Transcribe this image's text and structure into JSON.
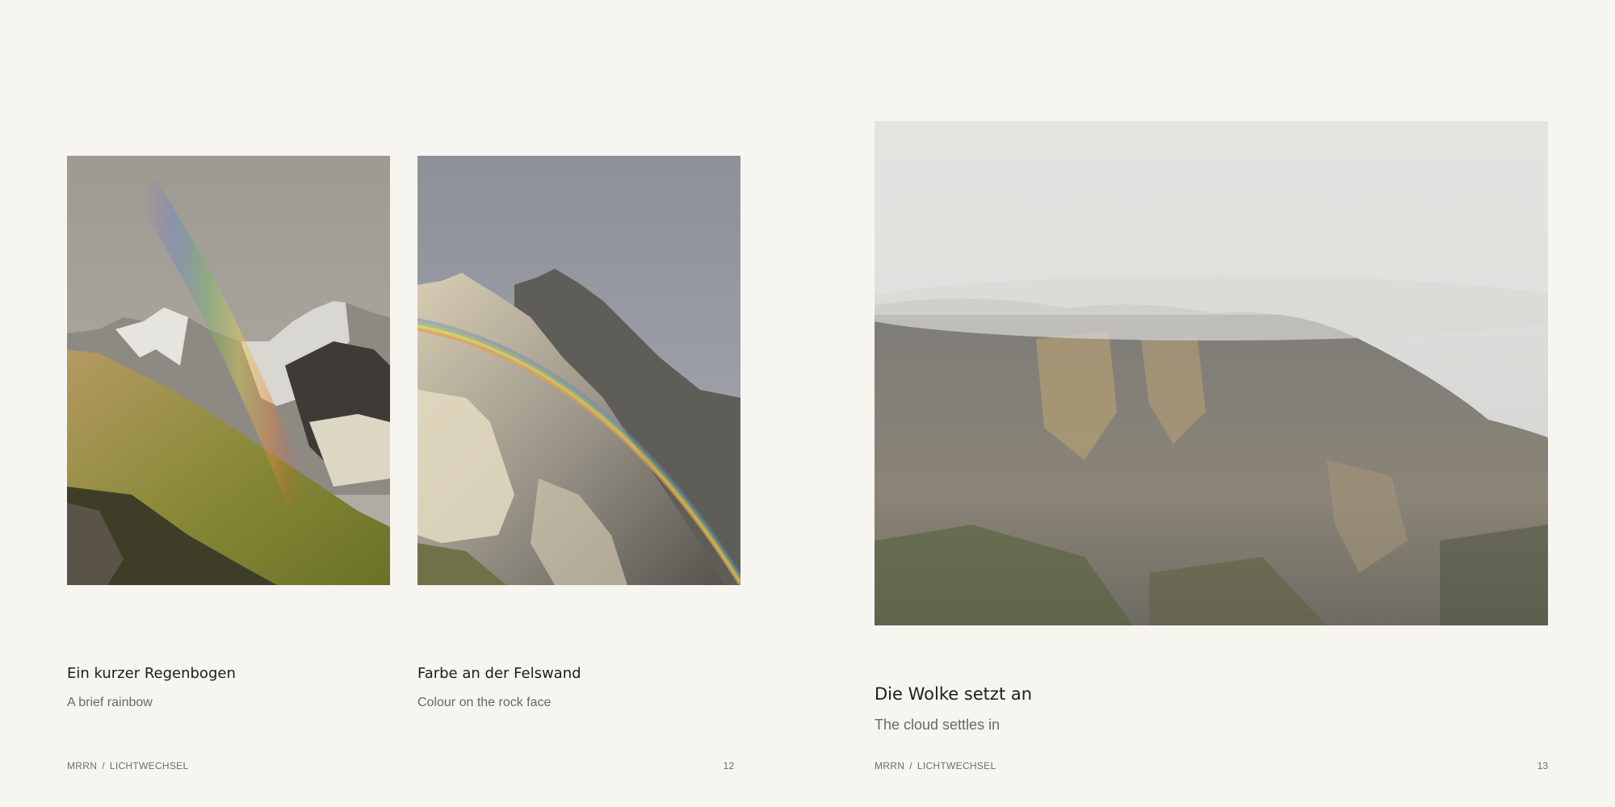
{
  "spreads": [
    {
      "captions": [
        {
          "title": "Ein kurzer Regenbogen",
          "subtitle": "A brief rainbow"
        },
        {
          "title": "Farbe an der Felswand",
          "subtitle": "Colour on the rock face"
        }
      ],
      "footer": {
        "brand": "MRRN",
        "separator": "/",
        "series": "LICHTWECHSEL"
      },
      "page_number": "12"
    },
    {
      "captions": [
        {
          "title": "Die Wolke setzt an",
          "subtitle": "The cloud settles in"
        }
      ],
      "footer": {
        "brand": "MRRN",
        "separator": "/",
        "series": "LICHTWECHSEL"
      },
      "page_number": "13"
    }
  ],
  "colors": {
    "background": "#f6f5f0",
    "title_text": "#1d1d1b",
    "subtitle_text": "#6a6864"
  }
}
